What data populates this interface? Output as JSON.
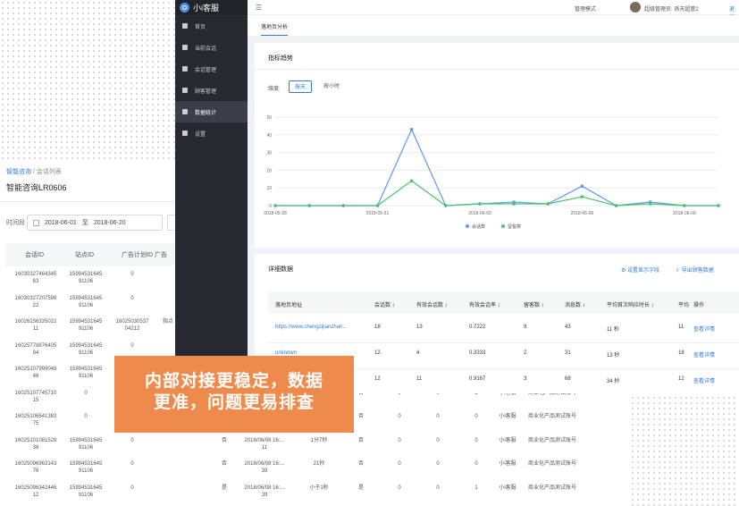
{
  "back": {
    "breadcrumb": {
      "root": "智能咨询",
      "sep": "/",
      "current": "会话列表"
    },
    "title": "智能咨询LR0606",
    "filter_label": "时间段",
    "date_start": "2018-06-01",
    "date_to": "至",
    "date_end": "2018-06-20",
    "columns": [
      "会话ID",
      "站点ID",
      "广告计划ID",
      "广告"
    ],
    "rows": [
      [
        "16030327464345\n63",
        "15994531645\n91106",
        "0",
        "",
        "",
        "",
        "",
        "",
        "",
        "",
        "",
        ""
      ],
      [
        "16030327207598\n22",
        "15994531645\n91106",
        "0",
        "",
        "",
        "",
        "",
        "",
        "",
        "",
        "",
        ""
      ],
      [
        "16026156335022\n11",
        "15994531645\n91106",
        "16025030537\n04212",
        "指点",
        "",
        "",
        "",
        "",
        "",
        "",
        "",
        ""
      ],
      [
        "16025778876405\n84",
        "15994531645\n91106",
        "0",
        "",
        "",
        "",
        "",
        "",
        "",
        "",
        "",
        ""
      ],
      [
        "16025107999048\n46",
        "15994531645\n91106",
        "0",
        "",
        "",
        "",
        "",
        "",
        "",
        "",
        "",
        ""
      ],
      [
        "16025107745710\n15",
        "0",
        "0",
        "",
        "否",
        "",
        "",
        "否",
        "0",
        "0",
        "1",
        "小i客服",
        "商业化产品测试账号"
      ],
      [
        "16025106541383\n75",
        "0",
        "0",
        "",
        "否",
        "",
        "",
        "否",
        "0",
        "0",
        "0",
        "小i客服",
        "商业化产品测试账号"
      ],
      [
        "16025101081528\n36",
        "15994531645\n91106",
        "0",
        "",
        "否",
        "2018/06/08 16:...\n11",
        "1分7秒",
        "否",
        "0",
        "0",
        "0",
        "小i客服",
        "商业化产品测试账号"
      ],
      [
        "16025096963143\n76",
        "15994531645\n91106",
        "0",
        "",
        "否",
        "2018/06/08 16:...\n39",
        "21秒",
        "否",
        "0",
        "0",
        "0",
        "小i客服",
        "商业化产品测试账号"
      ],
      [
        "16025096342446\n12",
        "15994531645\n91106",
        "0",
        "",
        "是",
        "2018/06/08 16:...\n39",
        "小于1秒",
        "是",
        "0",
        "0",
        "1",
        "小i客服",
        "商业化产品测试账号"
      ]
    ]
  },
  "front": {
    "logo_text": "小i客服",
    "sidebar": [
      {
        "label": "首页",
        "icon": "home-icon"
      },
      {
        "label": "当前会话",
        "icon": "chat-icon"
      },
      {
        "label": "会话管理",
        "icon": "session-icon"
      },
      {
        "label": "顾客管理",
        "icon": "user-icon"
      },
      {
        "label": "数据统计",
        "icon": "stats-icon",
        "active": true
      },
      {
        "label": "设置",
        "icon": "gear-icon"
      }
    ],
    "topbar": {
      "mode": "管理模式 ·",
      "user": "超级管理员: 孫天超管2",
      "logout": "退出"
    },
    "tab": "落地页分析",
    "trend": {
      "title": "指标趋势",
      "dim_label": "维度:",
      "btn_day": "按天",
      "btn_hour": "按小时"
    },
    "detail": {
      "title": "详细数据",
      "action_fields": "设置显示字段",
      "action_export": "导出顾客数据",
      "columns": [
        "落地页地址",
        "会话数 ↕",
        "有效会话数 ↕",
        "有效会话率 ↕",
        "留客数 ↕",
        "消息数 ↕",
        "平均首次响应时长 ↕",
        "平均",
        "操作"
      ],
      "rows": [
        [
          "https://www.chengzijianzhan...",
          "18",
          "13",
          "0.7222",
          "9",
          "43",
          "11 秒",
          "11",
          "查看详情"
        ],
        [
          "unknown",
          "12",
          "4",
          "0.3333",
          "2",
          "31",
          "13 秒",
          "18",
          "查看详情"
        ],
        [
          "https://www.chengzijianzhan...",
          "12",
          "11",
          "0.9167",
          "3",
          "68",
          "34 秒",
          "12",
          "查看详情"
        ]
      ]
    }
  },
  "banner": {
    "line1": "内部对接更稳定，数据",
    "line2": "更准，问题更易排查"
  },
  "chart_data": {
    "type": "line",
    "x": [
      "2018-05-28",
      "2018-05-29",
      "2018-05-30",
      "2018-05-31",
      "2018-06-01",
      "2018-06-02",
      "2018-06-03",
      "2018-06-04",
      "2018-06-05",
      "2018-06-06",
      "2018-06-07",
      "2018-06-08",
      "2018-06-09",
      "2018-06-10"
    ],
    "x_ticks": [
      "2018-05-28",
      "2018-05-31",
      "2018-06-03",
      "2018-06-06",
      "2018-06-09"
    ],
    "y_ticks": [
      0,
      10,
      20,
      30,
      40,
      50
    ],
    "ylim": [
      0,
      50
    ],
    "series": [
      {
        "name": "会话数",
        "color": "#5b9bf0",
        "values": [
          0,
          0,
          0,
          0,
          43,
          0,
          1,
          2,
          1,
          11,
          0,
          2,
          0,
          0
        ]
      },
      {
        "name": "留客数",
        "color": "#4cc46e",
        "values": [
          0,
          0,
          0,
          0,
          14,
          0,
          1,
          1,
          1,
          5,
          0,
          1,
          0,
          0
        ]
      }
    ],
    "legend": "bottom"
  }
}
